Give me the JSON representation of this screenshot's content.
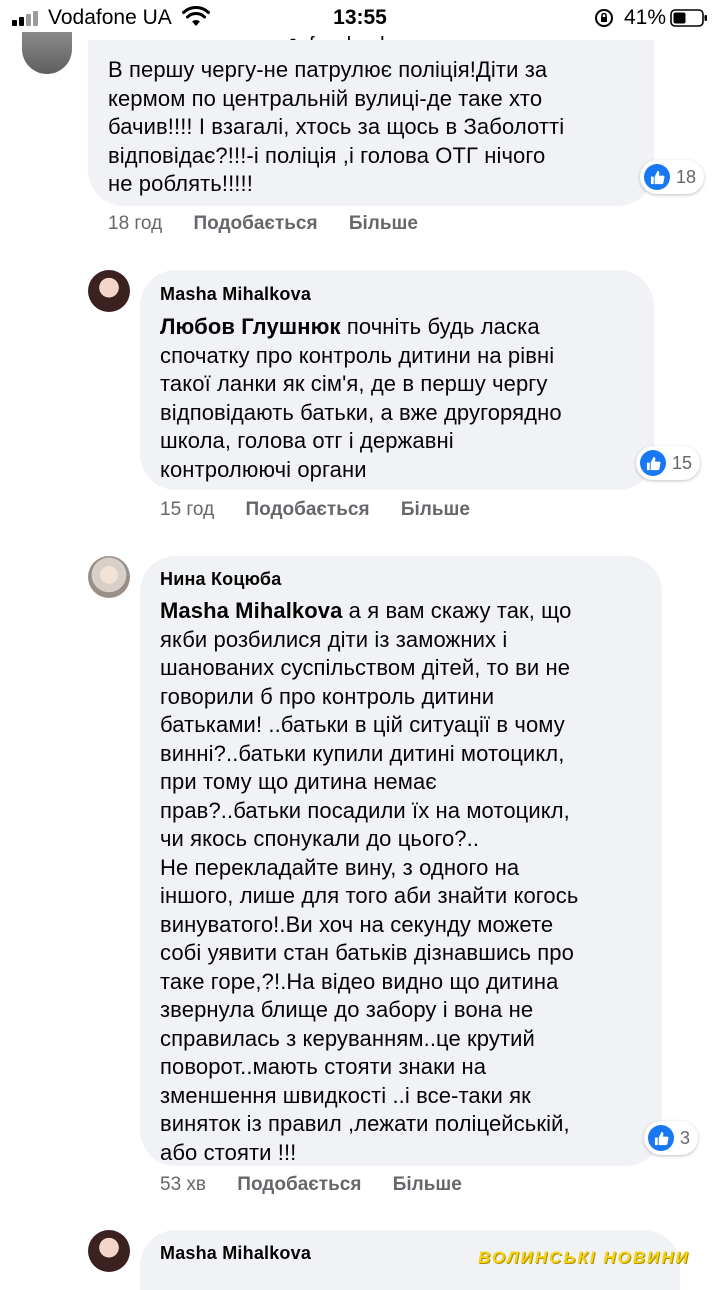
{
  "status": {
    "carrier": "Vodafone UA",
    "time": "13:55",
    "battery": "41%"
  },
  "browser": {
    "url": "facebook.com"
  },
  "comments": [
    {
      "text": "В першу чергу-не патрулює поліція!Діти за\nкермом по центральній вулиці-де таке хто\nбачив!!!! І взагалі, хтось за щось в Заболотті\nвідповідає?!!!-і поліція ,і голова ОТГ нічого\nне роблять!!!!!",
      "reactions": "18",
      "time": "18 год",
      "like": "Подобається",
      "more": "Більше"
    },
    {
      "author": "Masha Mihalkova",
      "mention": "Любов Глушнюк",
      "text": " почніть будь ласка\nспочатку про контроль дитини на рівні\nтакої ланки як сім'я, де в першу чергу\nвідповідають батьки, а вже другорядно\nшкола, голова отг і державні\nконтролюючі органи",
      "reactions": "15",
      "time": "15 год",
      "like": "Подобається",
      "more": "Більше"
    },
    {
      "author": "Нина Коцюба",
      "mention": "Masha Mihalkova",
      "text": " а я вам скажу так, що\nякби розбилися діти із заможних і\nшанованих суспільством дітей, то ви не\nговорили б про контроль дитини\nбатьками! ..батьки в цій ситуації в чому\nвинні?..батьки купили дитині мотоцикл,\nпри тому що дитина немає\nправ?..батьки посадили їх на мотоцикл,\nчи якось спонукали до цього?..\nНе перекладайте вину, з одного на\nіншого, лише для того аби знайти когось\nвинуватого!.Ви хоч на секунду можете\nсобі уявити стан батьків дізнавшись про\nтаке горе,?!.На відео видно що дитина\nзвернула блище до забору і вона не\nсправилась з керуванням..це крутий\nповорот..мають стояти знаки на\nзменшення швидкості ..і все-таки як\nвиняток із правил ,лежати поліцейській,\nабо стояти !!!",
      "reactions": "3",
      "time": "53 хв",
      "like": "Подобається",
      "more": "Більше"
    },
    {
      "author": "Masha Mihalkova"
    }
  ],
  "watermark": "ВОЛИНСЬКІ НОВИНИ",
  "colors": {
    "like_blue": "#1877f2",
    "bubble": "#f0f2f5",
    "meta_gray": "#65676b"
  }
}
